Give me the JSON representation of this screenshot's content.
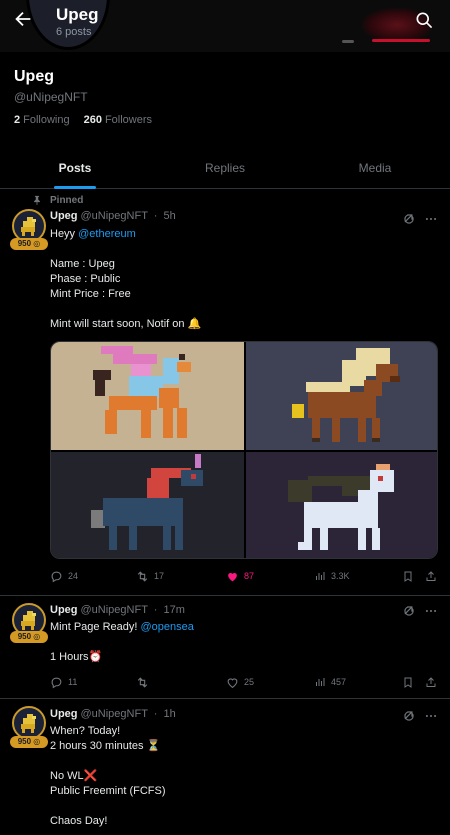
{
  "header": {
    "title": "Upeg",
    "post_count": "6 posts",
    "back_icon": "arrow-left-icon",
    "search_icon": "search-icon"
  },
  "profile": {
    "name": "Upeg",
    "handle": "@uNipegNFT",
    "following_count": "2",
    "following_label": "Following",
    "followers_count": "260",
    "followers_label": "Followers"
  },
  "tabs": [
    {
      "label": "Posts",
      "active": true
    },
    {
      "label": "Replies",
      "active": false
    },
    {
      "label": "Media",
      "active": false
    }
  ],
  "colors": {
    "accent": "#1d9bf0",
    "like": "#f91880",
    "badge": "#d49a24",
    "background": "#000000",
    "muted": "#71767b"
  },
  "tweets": [
    {
      "pinned_label": "Pinned",
      "name": "Upeg",
      "handle": "@uNipegNFT",
      "sep": "·",
      "time": "5h",
      "badge": "950",
      "text_before": "Heyy ",
      "mention": "@ethereum",
      "text_after": "\n\nName : Upeg\nPhase : Public\nMint Price : Free\n\nMint will start soon, Notif on 🔔",
      "replies": "24",
      "retweets": "17",
      "likes": "87",
      "views": "3.3K",
      "media": [
        {
          "alt": "pink-blue pixel unicorn on beige"
        },
        {
          "alt": "blonde-maned brown pixel horse on slate"
        },
        {
          "alt": "navy pixel unicorn with red mane on dark"
        },
        {
          "alt": "white pixel unicorn with dark mane on purple"
        }
      ]
    },
    {
      "name": "Upeg",
      "handle": "@uNipegNFT",
      "sep": "·",
      "time": "17m",
      "badge": "950",
      "text_before": "Mint Page Ready! ",
      "mention": "@opensea",
      "text_after": "\n\n1 Hours⏰",
      "replies": "11",
      "retweets": "",
      "likes": "25",
      "views": "457"
    },
    {
      "name": "Upeg",
      "handle": "@uNipegNFT",
      "sep": "·",
      "time": "1h",
      "badge": "950",
      "text_before": "When? Today!\n2 hours 30 minutes ⏳\n\nNo WL❌\nPublic Freemint (FCFS)\n\nChaos Day!",
      "mention": "",
      "text_after": ""
    }
  ]
}
